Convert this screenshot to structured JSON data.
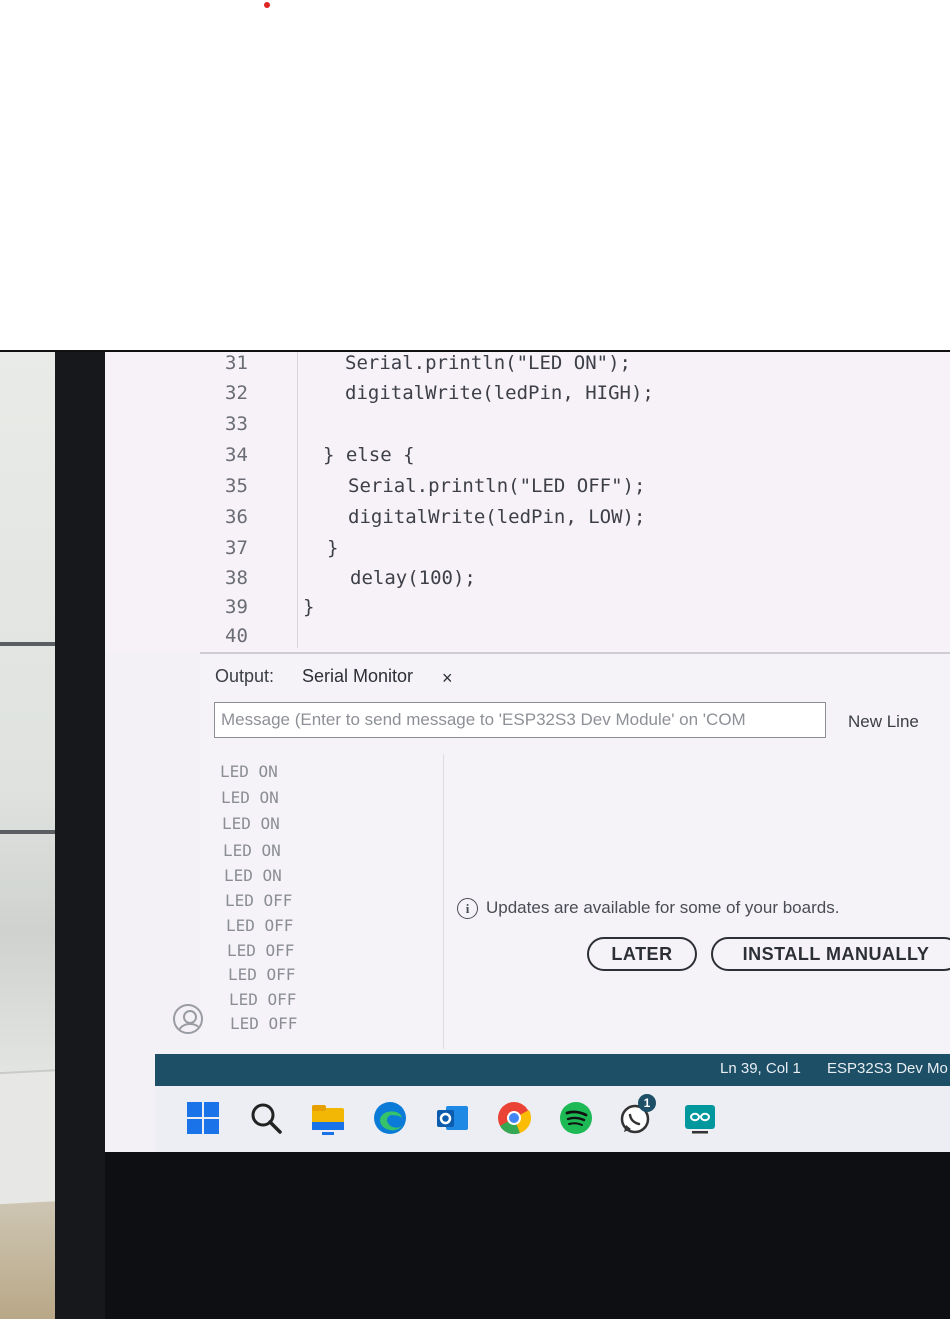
{
  "code_lines": [
    {
      "ln": "31",
      "text": "Serial.println(\"LED ON\");"
    },
    {
      "ln": "32",
      "text": "digitalWrite(ledPin, HIGH);"
    },
    {
      "ln": "33",
      "text": ""
    },
    {
      "ln": "34",
      "text": "} else {"
    },
    {
      "ln": "35",
      "text": "Serial.println(\"LED OFF\");"
    },
    {
      "ln": "36",
      "text": "digitalWrite(ledPin, LOW);"
    },
    {
      "ln": "37",
      "text": "}"
    },
    {
      "ln": "38",
      "text": "delay(100);"
    },
    {
      "ln": "39",
      "text": "}"
    },
    {
      "ln": "40",
      "text": ""
    }
  ],
  "panel": {
    "tab_output": "Output",
    "tab_serial": "Serial Monitor",
    "close_glyph": "×",
    "message_placeholder": "Message (Enter to send message to 'ESP32S3 Dev Module' on 'COM",
    "line_ending": "New Line"
  },
  "serial_output": [
    "LED ON",
    "LED ON",
    "LED ON",
    "LED ON",
    "LED ON",
    "LED OFF",
    "LED OFF",
    "LED OFF",
    "LED OFF",
    "LED OFF",
    "LED OFF"
  ],
  "notification": {
    "message": "Updates are available for some of your boards.",
    "later_label": "LATER",
    "install_label": "INSTALL MANUALLY",
    "icon": "info-icon"
  },
  "status_bar": {
    "position": "Ln 39, Col 1",
    "board": "ESP32S3 Dev Mo"
  },
  "taskbar": {
    "icons": [
      "windows-start-icon",
      "search-icon",
      "file-explorer-icon",
      "edge-icon",
      "outlook-icon",
      "chrome-icon",
      "spotify-icon",
      "whatsapp-icon",
      "arduino-ide-icon"
    ],
    "whatsapp_badge": "1"
  },
  "colors": {
    "status_bar": "#1d4f67",
    "record_dot": "#e02424"
  }
}
